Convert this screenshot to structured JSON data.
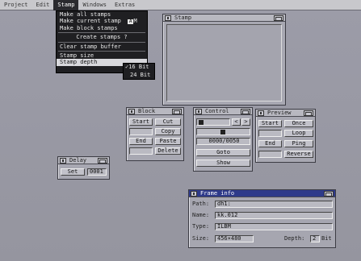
{
  "menubar": {
    "items": [
      "Project",
      "Edit",
      "Stamp",
      "Windows",
      "Extras"
    ],
    "active": "Stamp"
  },
  "stamp_menu": {
    "make_all": "Make all stamps",
    "make_current": "Make current stamp",
    "make_current_shortcut": "M",
    "make_block": "Make block stamps",
    "create": "Create stamps ?",
    "clear": "Clear stamp buffer",
    "size": "Stamp size",
    "depth": "Stamp depth",
    "depth_options": [
      "16 Bit",
      "24 Bit"
    ],
    "depth_selected": "16 Bit"
  },
  "stamp_window": {
    "title": "Stamp"
  },
  "block_window": {
    "title": "Block",
    "start": "Start",
    "cut": "Cut",
    "copy": "Copy",
    "end": "End",
    "paste": "Paste",
    "delete": "Delete"
  },
  "control_window": {
    "title": "Control",
    "frame_counter": "0000/0050",
    "goto": "Goto",
    "show": "Show"
  },
  "preview_window": {
    "title": "Preview",
    "start": "Start",
    "once": "Once",
    "loop": "Loop",
    "end": "End",
    "ping": "Ping",
    "reverse": "Reverse"
  },
  "delay_window": {
    "title": "Delay",
    "set": "Set",
    "value": "0001"
  },
  "frame_info": {
    "title": "Frame info",
    "path_label": "Path:",
    "path_value": "dh1:",
    "name_label": "Name:",
    "name_value": "kk.012",
    "type_label": "Type:",
    "type_value": "ILBM",
    "size_label": "Size:",
    "size_value": "456×480",
    "depth_label": "Depth:",
    "depth_value": "2",
    "depth_unit": "Bit"
  }
}
